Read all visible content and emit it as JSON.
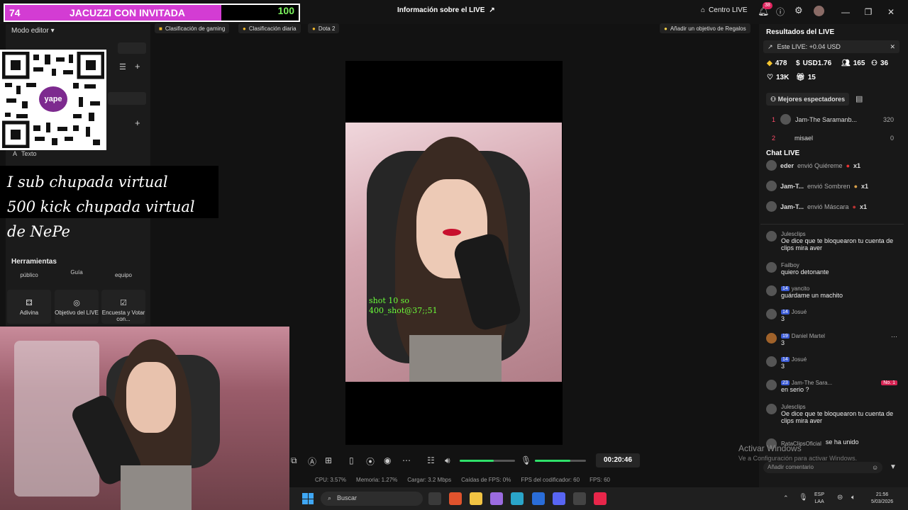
{
  "window": {
    "title": "Información sobre el LIVE",
    "centro": "Centro LIVE",
    "notif_count": "38"
  },
  "overlay": {
    "left_num": "74",
    "title": "JACUZZI CON INVITADA",
    "right_num": "100",
    "promo_line1": "I sub chupada virtual",
    "promo_line2": "500 kick chupada virtual de NePe",
    "qr_brand": "yape"
  },
  "left": {
    "modo": "Modo editor",
    "texto": "Texto",
    "herramientas": "Herramientas",
    "tools_top": [
      "público",
      "Guía",
      "equipo"
    ],
    "tools": [
      {
        "label": "Adivina",
        "icon": "dice-icon"
      },
      {
        "label": "Objetivo del LIVE",
        "icon": "target-icon"
      },
      {
        "label": "Encuesta y Votar con...",
        "icon": "poll-icon"
      }
    ]
  },
  "chips": {
    "c1": "Clasificación de gaming",
    "c2": "Clasificación diaria",
    "c3": "Dota 2",
    "goal": "Añadir un objetivo de Regalos"
  },
  "video": {
    "shot1": "shot 10 so",
    "shot2": "400_shot@37;;51"
  },
  "controls": {
    "timer": "00:20:46",
    "volume": 0.62,
    "mic": 0.7
  },
  "stats": {
    "cpu": "CPU: 3.57%",
    "mem": "Memoria: 1.27%",
    "upload": "Cargar: 3.2 Mbps",
    "fps_drop": "Caídas de FPS: 0%",
    "fps_enc": "FPS del codificador: 60",
    "fps": "FPS: 60"
  },
  "results": {
    "title": "Resultados del LIVE",
    "este": "Este LIVE: +0.04 USD",
    "diamonds": "478",
    "usd": "USD1.76",
    "viewers": "165",
    "new": "36",
    "likes": "13K",
    "gifts": "15",
    "mejores": "Mejores espectadores",
    "rank1_pos": "1",
    "rank1_name": "Jam-The Saramanb...",
    "rank1_score": "320",
    "rank2_name": "misael",
    "rank2_pos": "2",
    "rank2_score": "0"
  },
  "chat": {
    "title": "Chat LIVE",
    "gifts": [
      {
        "user": "eder",
        "text": "envió Quiéreme",
        "count": "x1"
      },
      {
        "user": "Jam-T...",
        "text": "envió Sombren",
        "count": "x1"
      },
      {
        "user": "Jam-T...",
        "text": "envió Máscara",
        "count": "x1"
      }
    ],
    "messages": [
      {
        "user": "Julesclips",
        "level": "",
        "text": "Oe dice que te bloquearon tu cuenta de clips mira aver"
      },
      {
        "user": "Failboy",
        "level": "",
        "text": "quiero detonante"
      },
      {
        "user": "yancito",
        "level": "14",
        "text": "guárdame un machito"
      },
      {
        "user": "Josué",
        "level": "14",
        "text": "3"
      },
      {
        "user": "Daniel Martel",
        "level": "19",
        "text": "3"
      },
      {
        "user": "Josué",
        "level": "14",
        "text": "3"
      },
      {
        "user": "Jam-The Sara...",
        "level": "23",
        "text": "en serio ?",
        "rank": "No. 1"
      },
      {
        "user": "Julesclips",
        "level": "",
        "text": "Oe dice que te bloquearon tu cuenta de clips mira aver"
      },
      {
        "user": "RataClipsOficial",
        "level": "",
        "text": "se ha unido"
      }
    ],
    "placeholder": "Añadir comentario"
  },
  "watermark": {
    "l1": "Activar Windows",
    "l2": "Ve a Configuración para activar Windows."
  },
  "taskbar": {
    "search": "Buscar",
    "lang1": "ESP",
    "lang2": "LAA",
    "time": "21:56",
    "date": "5/03/2026"
  }
}
